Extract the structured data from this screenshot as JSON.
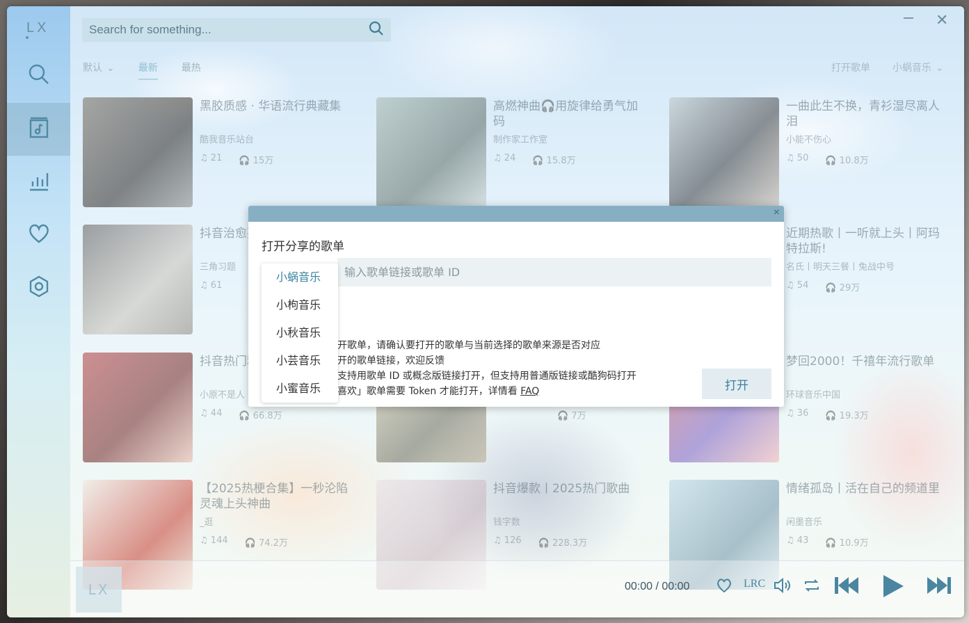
{
  "app": {
    "logo": "LX"
  },
  "sidebar": {
    "items": [
      {
        "name": "search",
        "icon": "search-icon"
      },
      {
        "name": "songlist",
        "icon": "songlist-icon",
        "active": true
      },
      {
        "name": "leaderboard",
        "icon": "chart-bars-icon"
      },
      {
        "name": "favorites",
        "icon": "heart-icon"
      },
      {
        "name": "settings",
        "icon": "settings-hexagon-icon"
      }
    ]
  },
  "search": {
    "placeholder": "Search for something..."
  },
  "sort": {
    "default_label": "默认",
    "latest": "最新",
    "hottest": "最热"
  },
  "toolbar": {
    "open_playlist": "打开歌单",
    "source": "小蜗音乐"
  },
  "cards": [
    {
      "title": "黑胶质感 · 华语流行典藏集",
      "author": "酷我音乐站台",
      "count": "21",
      "plays": "15万"
    },
    {
      "title": "高燃神曲🎧用旋律给勇气加码",
      "author": "制作家工作室",
      "count": "24",
      "plays": "15.8万"
    },
    {
      "title": "一曲此生不换，青衫湿尽离人泪",
      "author": "小能不伤心",
      "count": "50",
      "plays": "10.8万"
    },
    {
      "title": "抖音治愈孤独疗愈",
      "author": "三角习题",
      "count": "61",
      "plays": ""
    },
    {
      "title": "",
      "author": "",
      "count": "",
      "plays": ""
    },
    {
      "title": "近期热歌丨一听就上头丨阿玛特拉斯!",
      "author": "名氏丨明天三餐丨兔战中号",
      "count": "54",
      "plays": "29万"
    },
    {
      "title": "抖音热门精选",
      "author": "小原不是人",
      "count": "44",
      "plays": "66.8万"
    },
    {
      "title": "",
      "author": "",
      "count": "",
      "plays": "7万"
    },
    {
      "title": "梦回2000！千禧年流行歌单",
      "author": "环球音乐中国",
      "count": "36",
      "plays": "19.3万"
    },
    {
      "title": "【2025热梗合集】一秒沦陷灵魂上头神曲",
      "author": "_逛",
      "count": "144",
      "plays": "74.2万"
    },
    {
      "title": "抖音爆款丨2025热门歌曲",
      "author": "钱字数",
      "count": "126",
      "plays": "228.3万"
    },
    {
      "title": "情绪孤岛丨活在自己的频道里",
      "author": "闲墨音乐",
      "count": "43",
      "plays": "10.9万"
    }
  ],
  "player": {
    "cover_text": "LX",
    "current": "00:00",
    "separator": "/",
    "total": "00:00"
  },
  "modal": {
    "title": "打开分享的歌单",
    "input_placeholder": "输入歌单链接或歌单 ID",
    "tips": [
      "开歌单，请确认要打开的歌单与当前选择的歌单来源是否对应",
      "开的歌单链接，欢迎反馈",
      "支持用歌单 ID 或概念版链接打开，但支持用普通版链接或酷狗码打开",
      "喜欢」歌单需要 Token 才能打开，详情看 "
    ],
    "faq": "FAQ",
    "open_button": "打开",
    "close": "×",
    "sources": [
      "小蜗音乐",
      "小枸音乐",
      "小秋音乐",
      "小芸音乐",
      "小蜜音乐"
    ]
  },
  "colors": {
    "accent": "#4a86a0",
    "modal_header": "#86afc2"
  }
}
